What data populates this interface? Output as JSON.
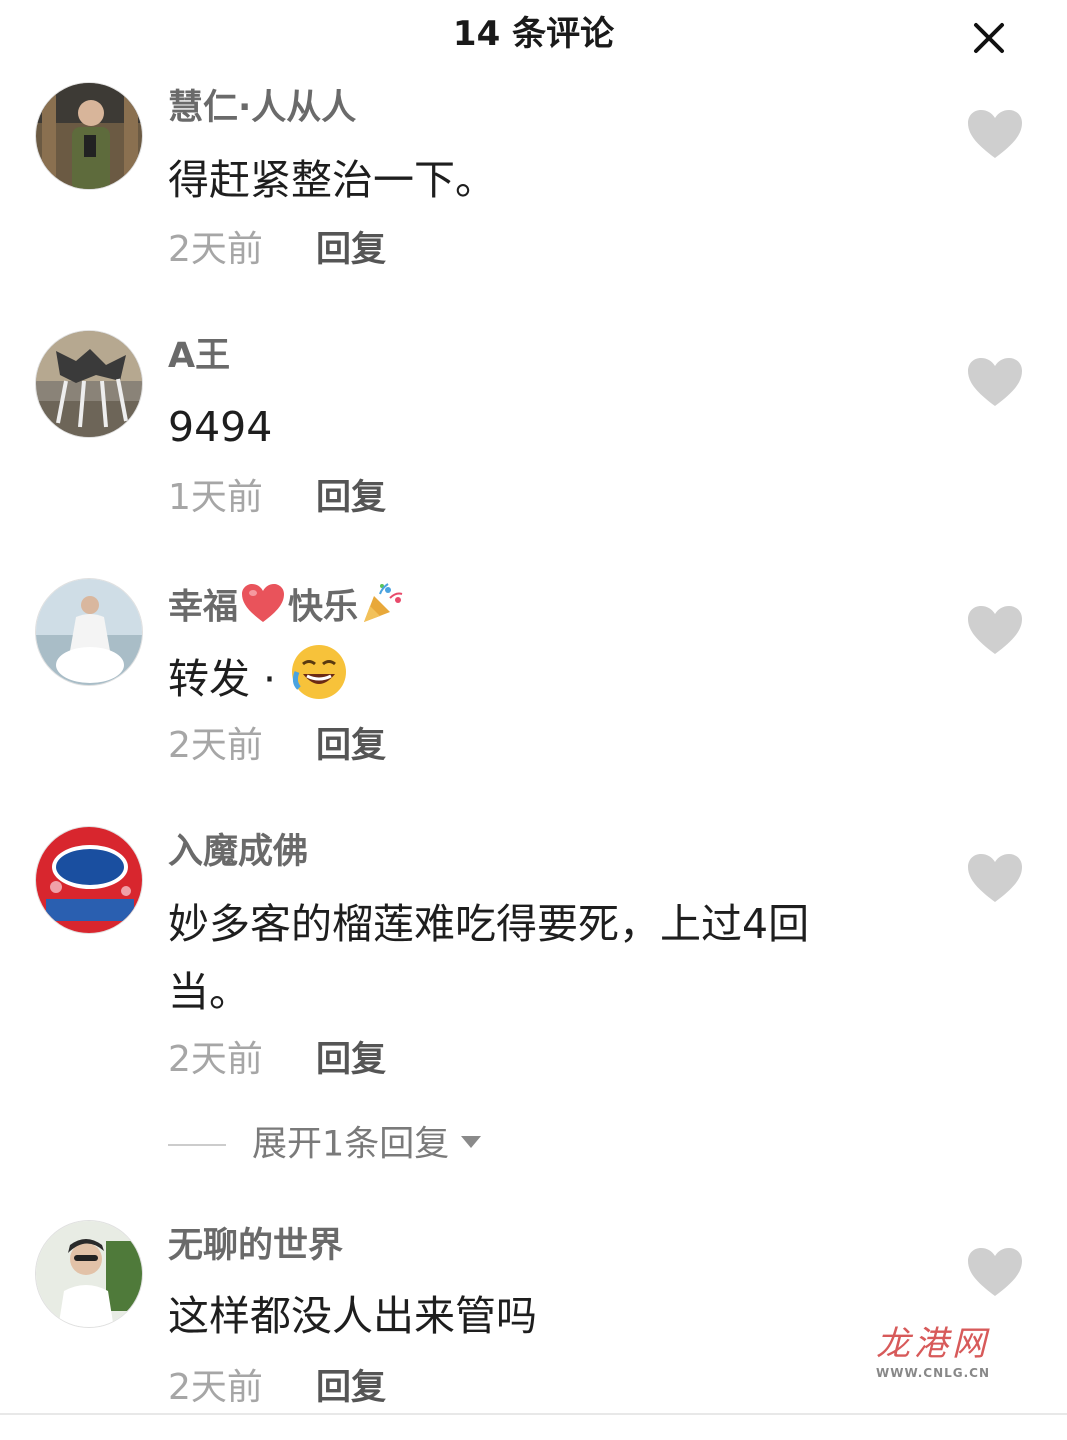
{
  "header": {
    "title": "14 条评论"
  },
  "comments": [
    {
      "username": "慧仁·人从人",
      "text": "得赶紧整治一下。",
      "time": "2天前",
      "reply_label": "回复"
    },
    {
      "username": "A王",
      "text": "9494",
      "time": "1天前",
      "reply_label": "回复"
    },
    {
      "username": "幸福",
      "username_2": "快乐",
      "text": "转发 ·",
      "time": "2天前",
      "reply_label": "回复"
    },
    {
      "username": "入魔成佛",
      "text": "妙多客的榴莲难吃得要死，上过4回当。",
      "time": "2天前",
      "reply_label": "回复",
      "expand_label": "展开1条回复"
    },
    {
      "username": "无聊的世界",
      "text": "这样都没人出来管吗",
      "time": "2天前",
      "reply_label": "回复"
    }
  ],
  "watermark": {
    "title": "龙港网",
    "url": "WWW.CNLG.CN"
  },
  "colors": {
    "like_heart": "#cfcfcf",
    "username": "#6a6a6a",
    "time": "#a6a6a6",
    "watermark": "#d75a5a"
  }
}
